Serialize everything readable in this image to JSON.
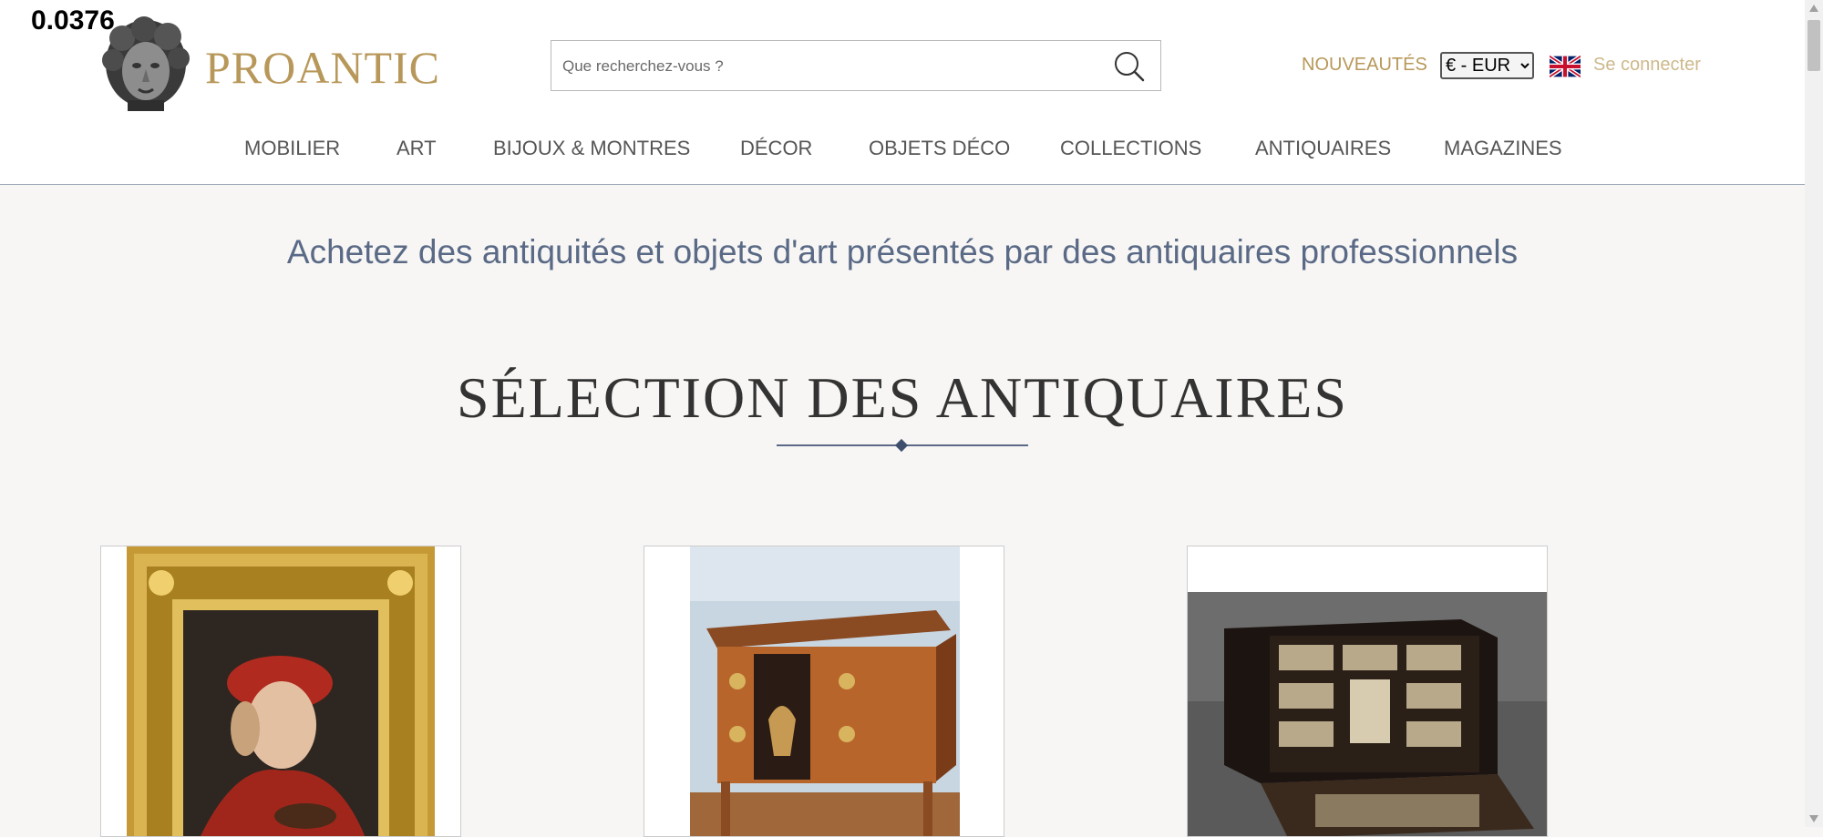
{
  "overlay_number": "0.0376",
  "header": {
    "brand": "PROANTIC",
    "search": {
      "placeholder": "Que recherchez-vous ?",
      "value": ""
    },
    "nouveautes": "NOUVEAUTÉS",
    "currency_options": [
      "€ - EUR"
    ],
    "currency_selected": "€ - EUR",
    "login": "Se connecter",
    "language_flag": "uk-flag-icon"
  },
  "nav": {
    "items": [
      {
        "label": "MOBILIER"
      },
      {
        "label": "ART"
      },
      {
        "label": "BIJOUX & MONTRES"
      },
      {
        "label": "DÉCOR"
      },
      {
        "label": "OBJETS DÉCO"
      },
      {
        "label": "COLLECTIONS"
      },
      {
        "label": "ANTIQUAIRES"
      },
      {
        "label": "MAGAZINES"
      }
    ]
  },
  "main": {
    "tagline": "Achetez des antiquités et objets d'art présentés par des antiquaires professionnels",
    "section_title": "SÉLECTION DES ANTIQUAIRES",
    "cards": [
      {
        "image": "gilded-frame-portrait-painting"
      },
      {
        "image": "marquetry-commode"
      },
      {
        "image": "ebony-ivory-cabinet"
      }
    ]
  },
  "colors": {
    "brand_gold": "#b8985a",
    "login_gold": "#cdb98c",
    "slate_blue": "#5a6a86",
    "page_bg": "#f7f6f4"
  }
}
